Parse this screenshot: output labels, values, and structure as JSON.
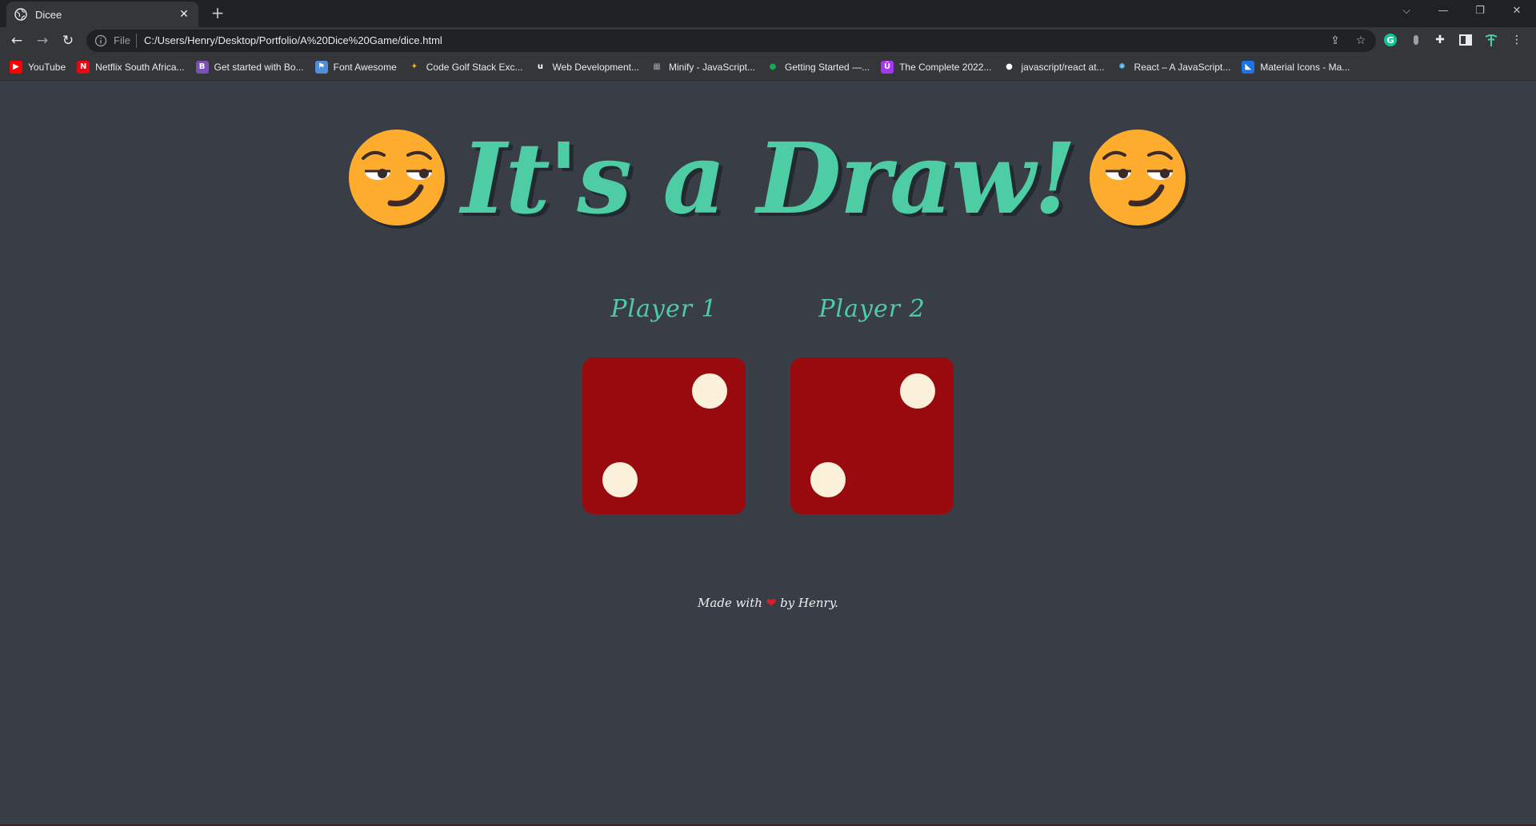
{
  "browser": {
    "tab": {
      "title": "Dicee",
      "icon": "globe-icon",
      "close": "✕"
    },
    "new_tab": "+",
    "window_controls": {
      "dropdown": "⌵",
      "minimize": "—",
      "restore": "❐",
      "close": "✕"
    },
    "nav": {
      "back": "←",
      "forward": "→",
      "reload": "↻"
    },
    "address_bar": {
      "scheme_label": "File",
      "url": "C:/Users/Henry/Desktop/Portfolio/A%20Dice%20Game/dice.html"
    },
    "toolbar_icons": [
      "share-icon",
      "star-icon",
      "grammarly-icon",
      "extension-icon",
      "puzzle-icon",
      "sidebar-icon",
      "profile-icon",
      "menu-icon"
    ],
    "bookmarks": [
      {
        "label": "YouTube",
        "icon": "youtube-icon",
        "color": "#ff0000"
      },
      {
        "label": "Netflix South Africa...",
        "icon": "netflix-icon",
        "color": "#e50914"
      },
      {
        "label": "Get started with Bo...",
        "icon": "bootstrap-icon",
        "color": "#7952b3"
      },
      {
        "label": "Font Awesome",
        "icon": "flag-icon",
        "color": "#528dd7"
      },
      {
        "label": "Code Golf Stack Exc...",
        "icon": "medal-icon",
        "color": "#f5b800"
      },
      {
        "label": "Web Development...",
        "icon": "udemy-icon",
        "color": "#ffffff"
      },
      {
        "label": "Minify - JavaScript...",
        "icon": "minify-icon",
        "color": "#9aa0a6"
      },
      {
        "label": "Getting Started —...",
        "icon": "mongodb-icon",
        "color": "#13aa52"
      },
      {
        "label": "The Complete 2022...",
        "icon": "udemy-purple-icon",
        "color": "#a435f0"
      },
      {
        "label": "javascript/react at...",
        "icon": "github-icon",
        "color": "#ffffff"
      },
      {
        "label": "React – A JavaScript...",
        "icon": "react-icon",
        "color": "#61dafb"
      },
      {
        "label": "Material Icons - Ma...",
        "icon": "material-icon",
        "color": "#1a73e8"
      }
    ]
  },
  "page": {
    "headline": "It's a Draw!",
    "headline_emoji": "smirking-face-icon",
    "players": [
      {
        "label": "Player 1",
        "die_value": 2
      },
      {
        "label": "Player 2",
        "die_value": 2
      }
    ],
    "footer": {
      "prefix": "Made with",
      "heart": "❤",
      "suffix": "by Henry."
    }
  },
  "colors": {
    "background": "#393e46",
    "accent": "#4ecca3",
    "die": "#990a0e",
    "pip": "#fbf0d9",
    "shadow": "#232931",
    "heart": "#e01e2a"
  }
}
